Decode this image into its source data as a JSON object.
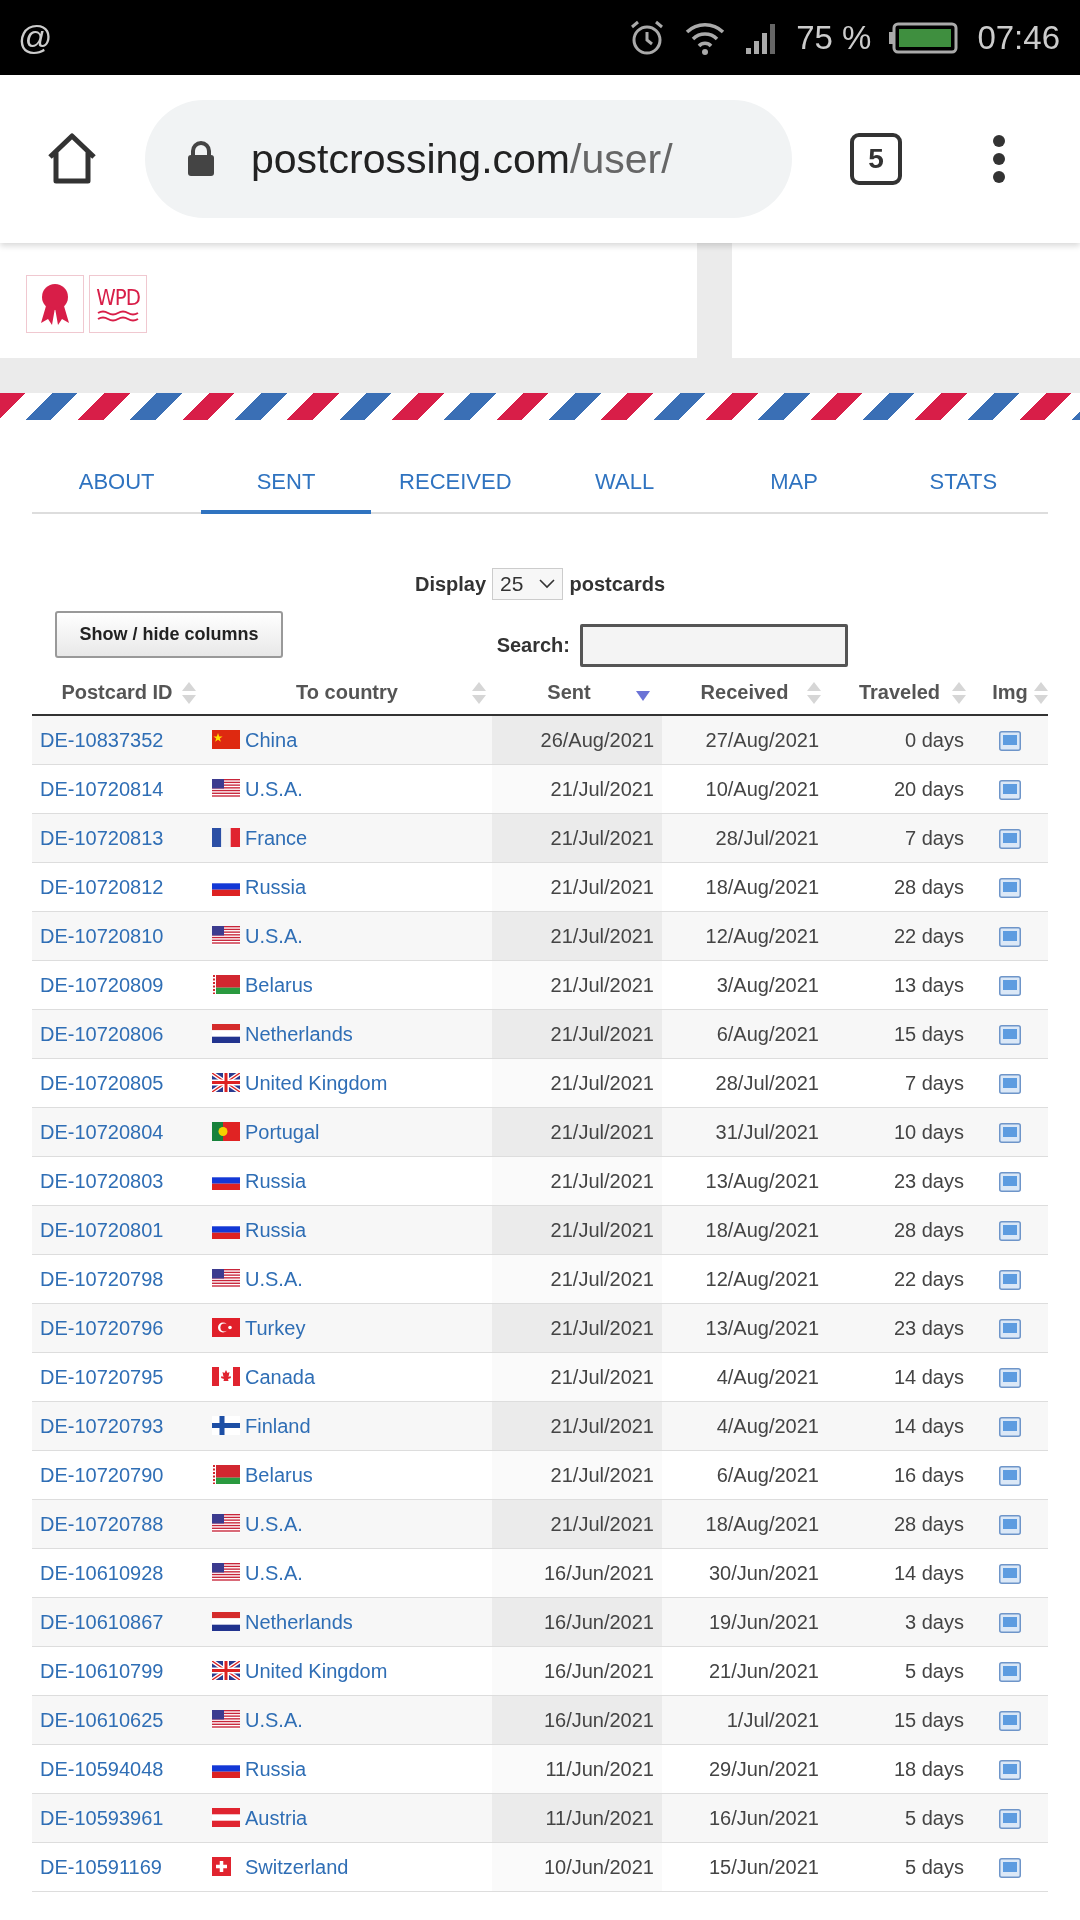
{
  "status_bar": {
    "notification": "@",
    "battery": "75 %",
    "time": "07:46"
  },
  "browser": {
    "url_host": "postcrossing.com",
    "url_path": "/user/",
    "tab_count": "5"
  },
  "badges": [
    {
      "kind": "rosette"
    },
    {
      "kind": "logo",
      "text": "WPD"
    }
  ],
  "tabs": [
    {
      "label": "ABOUT",
      "selected": false
    },
    {
      "label": "SENT",
      "selected": true
    },
    {
      "label": "RECEIVED",
      "selected": false
    },
    {
      "label": "WALL",
      "selected": false
    },
    {
      "label": "MAP",
      "selected": false
    },
    {
      "label": "STATS",
      "selected": false
    }
  ],
  "display": {
    "label": "Display",
    "value": "25",
    "suffix": "postcards"
  },
  "columns_button": "Show / hide columns",
  "search": {
    "label": "Search:"
  },
  "table": {
    "columns": [
      {
        "label": "Postcard ID",
        "sorted": false
      },
      {
        "label": "To country",
        "sorted": false
      },
      {
        "label": "Sent",
        "sorted": true
      },
      {
        "label": "Received",
        "sorted": false
      },
      {
        "label": "Traveled",
        "sorted": false
      },
      {
        "label": "Img",
        "sorted": false
      }
    ],
    "rows": [
      {
        "id": "DE-10837352",
        "kind": "cn",
        "country": "China",
        "sent": "26/Aug/2021",
        "received": "27/Aug/2021",
        "traveled": "0 days"
      },
      {
        "id": "DE-10720814",
        "kind": "us",
        "country": "U.S.A.",
        "sent": "21/Jul/2021",
        "received": "10/Aug/2021",
        "traveled": "20 days"
      },
      {
        "id": "DE-10720813",
        "kind": "fr",
        "country": "France",
        "sent": "21/Jul/2021",
        "received": "28/Jul/2021",
        "traveled": "7 days"
      },
      {
        "id": "DE-10720812",
        "kind": "ru",
        "country": "Russia",
        "sent": "21/Jul/2021",
        "received": "18/Aug/2021",
        "traveled": "28 days"
      },
      {
        "id": "DE-10720810",
        "kind": "us",
        "country": "U.S.A.",
        "sent": "21/Jul/2021",
        "received": "12/Aug/2021",
        "traveled": "22 days"
      },
      {
        "id": "DE-10720809",
        "kind": "by",
        "country": "Belarus",
        "sent": "21/Jul/2021",
        "received": "3/Aug/2021",
        "traveled": "13 days"
      },
      {
        "id": "DE-10720806",
        "kind": "nl",
        "country": "Netherlands",
        "sent": "21/Jul/2021",
        "received": "6/Aug/2021",
        "traveled": "15 days"
      },
      {
        "id": "DE-10720805",
        "kind": "gb",
        "country": "United Kingdom",
        "sent": "21/Jul/2021",
        "received": "28/Jul/2021",
        "traveled": "7 days"
      },
      {
        "id": "DE-10720804",
        "kind": "pt",
        "country": "Portugal",
        "sent": "21/Jul/2021",
        "received": "31/Jul/2021",
        "traveled": "10 days"
      },
      {
        "id": "DE-10720803",
        "kind": "ru",
        "country": "Russia",
        "sent": "21/Jul/2021",
        "received": "13/Aug/2021",
        "traveled": "23 days"
      },
      {
        "id": "DE-10720801",
        "kind": "ru",
        "country": "Russia",
        "sent": "21/Jul/2021",
        "received": "18/Aug/2021",
        "traveled": "28 days"
      },
      {
        "id": "DE-10720798",
        "kind": "us",
        "country": "U.S.A.",
        "sent": "21/Jul/2021",
        "received": "12/Aug/2021",
        "traveled": "22 days"
      },
      {
        "id": "DE-10720796",
        "kind": "tr",
        "country": "Turkey",
        "sent": "21/Jul/2021",
        "received": "13/Aug/2021",
        "traveled": "23 days"
      },
      {
        "id": "DE-10720795",
        "kind": "ca",
        "country": "Canada",
        "sent": "21/Jul/2021",
        "received": "4/Aug/2021",
        "traveled": "14 days"
      },
      {
        "id": "DE-10720793",
        "kind": "fi",
        "country": "Finland",
        "sent": "21/Jul/2021",
        "received": "4/Aug/2021",
        "traveled": "14 days"
      },
      {
        "id": "DE-10720790",
        "kind": "by",
        "country": "Belarus",
        "sent": "21/Jul/2021",
        "received": "6/Aug/2021",
        "traveled": "16 days"
      },
      {
        "id": "DE-10720788",
        "kind": "us",
        "country": "U.S.A.",
        "sent": "21/Jul/2021",
        "received": "18/Aug/2021",
        "traveled": "28 days"
      },
      {
        "id": "DE-10610928",
        "kind": "us",
        "country": "U.S.A.",
        "sent": "16/Jun/2021",
        "received": "30/Jun/2021",
        "traveled": "14 days"
      },
      {
        "id": "DE-10610867",
        "kind": "nl",
        "country": "Netherlands",
        "sent": "16/Jun/2021",
        "received": "19/Jun/2021",
        "traveled": "3 days"
      },
      {
        "id": "DE-10610799",
        "kind": "gb",
        "country": "United Kingdom",
        "sent": "16/Jun/2021",
        "received": "21/Jun/2021",
        "traveled": "5 days"
      },
      {
        "id": "DE-10610625",
        "kind": "us",
        "country": "U.S.A.",
        "sent": "16/Jun/2021",
        "received": "1/Jul/2021",
        "traveled": "15 days"
      },
      {
        "id": "DE-10594048",
        "kind": "ru",
        "country": "Russia",
        "sent": "11/Jun/2021",
        "received": "29/Jun/2021",
        "traveled": "18 days"
      },
      {
        "id": "DE-10593961",
        "kind": "at",
        "country": "Austria",
        "sent": "11/Jun/2021",
        "received": "16/Jun/2021",
        "traveled": "5 days"
      },
      {
        "id": "DE-10591169",
        "kind": "ch",
        "country": "Switzerland",
        "sent": "10/Jun/2021",
        "received": "15/Jun/2021",
        "traveled": "5 days"
      }
    ]
  }
}
